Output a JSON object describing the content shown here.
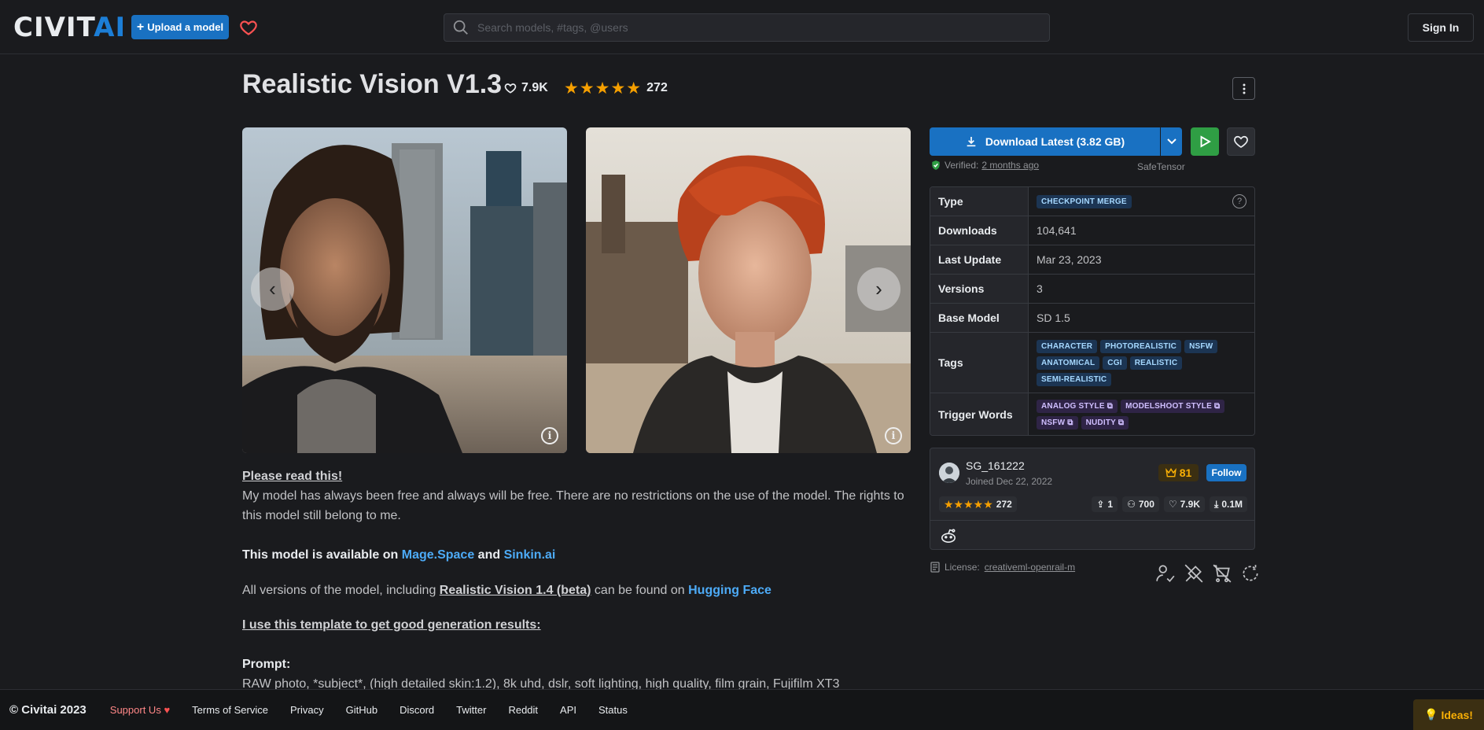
{
  "header": {
    "logo_part1": "CIVIT",
    "logo_part2": "AI",
    "upload_label": "Upload a model",
    "search_placeholder": "Search models, #tags, @users",
    "signin_label": "Sign In"
  },
  "model": {
    "title": "Realistic Vision V1.3",
    "likes": "7.9K",
    "rating_count": "272",
    "rating_stars": 5
  },
  "download": {
    "label": "Download Latest (3.82 GB)",
    "verified_label": "Verified:",
    "verified_ago": "2 months ago",
    "format": "SafeTensor"
  },
  "details": {
    "type_label": "Type",
    "type_value": "CHECKPOINT MERGE",
    "downloads_label": "Downloads",
    "downloads_value": "104,641",
    "last_update_label": "Last Update",
    "last_update_value": "Mar 23, 2023",
    "versions_label": "Versions",
    "versions_value": "3",
    "base_model_label": "Base Model",
    "base_model_value": "SD 1.5",
    "tags_label": "Tags",
    "tags": [
      "CHARACTER",
      "PHOTOREALISTIC",
      "NSFW",
      "ANATOMICAL",
      "CGI",
      "REALISTIC",
      "SEMI-REALISTIC"
    ],
    "trigger_label": "Trigger Words",
    "trigger_words": [
      "ANALOG STYLE",
      "MODELSHOOT STYLE",
      "NSFW",
      "NUDITY"
    ]
  },
  "creator": {
    "name": "SG_161222",
    "joined": "Joined Dec 22, 2022",
    "rank": "81",
    "follow_label": "Follow",
    "rating_count": "272",
    "uploads": "1",
    "followers": "700",
    "likes": "7.9K",
    "downloads": "0.1M"
  },
  "license": {
    "label": "License:",
    "value": "creativeml-openrail-m"
  },
  "description": {
    "heading1": "Please read this!",
    "para1": "My model has always been free and always will be free. There are no restrictions on the use of the model. The rights to this model still belong to me.",
    "avail_prefix": "This model is available on ",
    "avail_link1": "Mage.Space",
    "avail_and": " and ",
    "avail_link2": "Sinkin.ai",
    "versions_prefix": "All versions of the model, including ",
    "versions_link": "Realistic Vision 1.4 (beta)",
    "versions_mid": " can be found on ",
    "versions_hf": "Hugging Face",
    "template_heading": "I use this template to get good generation results:",
    "prompt_label": "Prompt:",
    "prompt_text": "RAW photo, *subject*, (high detailed skin:1.2), 8k uhd, dslr, soft lighting, high quality, film grain, Fujifilm XT3"
  },
  "footer": {
    "copyright": "© Civitai 2023",
    "support": "Support Us",
    "terms": "Terms of Service",
    "privacy": "Privacy",
    "github": "GitHub",
    "discord": "Discord",
    "twitter": "Twitter",
    "reddit": "Reddit",
    "api": "API",
    "status": "Status",
    "ideas": "Ideas!"
  },
  "colors": {
    "accent": "#1971c2",
    "star": "#f59f00",
    "background": "#1a1b1e"
  }
}
